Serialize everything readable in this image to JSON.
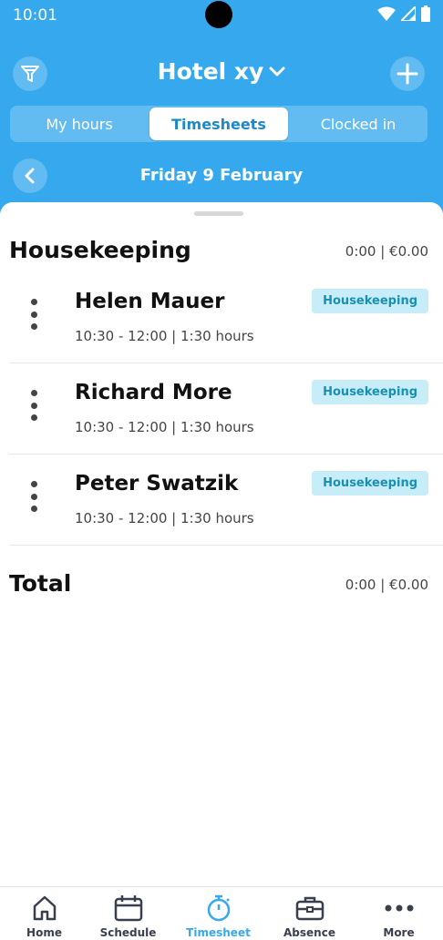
{
  "status_bar": {
    "time": "10:01"
  },
  "header": {
    "title": "Hotel xy",
    "icons": {
      "filter": "filter-icon",
      "add": "plus-icon",
      "dropdown": "chevron-down-icon"
    }
  },
  "tabs": [
    {
      "label": "My hours",
      "selected": false
    },
    {
      "label": "Timesheets",
      "selected": true
    },
    {
      "label": "Clocked in",
      "selected": false
    }
  ],
  "date_nav": {
    "label": "Friday 9 February",
    "back_icon": "chevron-left-icon"
  },
  "section": {
    "title": "Housekeeping",
    "summary": "0:00 | €0.00",
    "entries": [
      {
        "name": "Helen Mauer",
        "time": "10:30 - 12:00 | 1:30 hours",
        "badge": "Housekeeping"
      },
      {
        "name": "Richard More",
        "time": "10:30 - 12:00 | 1:30 hours",
        "badge": "Housekeeping"
      },
      {
        "name": "Peter Swatzik",
        "time": "10:30 - 12:00 | 1:30 hours",
        "badge": "Housekeeping"
      }
    ]
  },
  "total": {
    "label": "Total",
    "value": "0:00 | €0.00"
  },
  "bottom_nav": [
    {
      "label": "Home",
      "icon": "home-icon",
      "active": false
    },
    {
      "label": "Schedule",
      "icon": "calendar-icon",
      "active": false
    },
    {
      "label": "Timesheet",
      "icon": "stopwatch-icon",
      "active": true
    },
    {
      "label": "Absence",
      "icon": "briefcase-icon",
      "active": false
    },
    {
      "label": "More",
      "icon": "more-icon",
      "active": false
    }
  ],
  "colors": {
    "primary": "#36a9ee",
    "badge_bg": "#c7eef8",
    "badge_text": "#1a8fb5",
    "nav_text": "#3a3f4e"
  }
}
